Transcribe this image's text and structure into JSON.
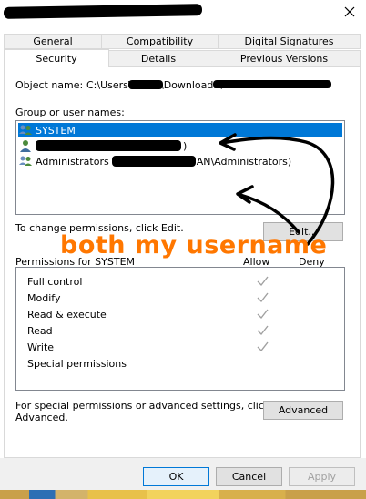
{
  "window": {
    "close_glyph": "✕"
  },
  "tabs": {
    "general": "General",
    "compatibility": "Compatibility",
    "digital_signatures": "Digital Signatures",
    "security": "Security",
    "details": "Details",
    "previous_versions": "Previous Versions"
  },
  "object": {
    "label": "Object name:",
    "path_start": "C:\\Users\\",
    "path_mid": "\\Downloads\\"
  },
  "groups": {
    "label": "Group or user names:",
    "items": [
      {
        "name": "SYSTEM",
        "icon": "group-users-icon",
        "selected": true
      },
      {
        "name": "",
        "suffix": ")",
        "icon": "user-icon",
        "selected": false
      },
      {
        "name": "Administrators",
        "suffix": "AN\\Administrators)",
        "icon": "group-users-icon",
        "selected": false
      }
    ]
  },
  "change_perm": {
    "text": "To change permissions, click Edit.",
    "edit_button": "Edit..."
  },
  "permissions": {
    "label": "Permissions for SYSTEM",
    "allow_header": "Allow",
    "deny_header": "Deny",
    "rows": [
      {
        "name": "Full control",
        "allow": true
      },
      {
        "name": "Modify",
        "allow": true
      },
      {
        "name": "Read & execute",
        "allow": true
      },
      {
        "name": "Read",
        "allow": true
      },
      {
        "name": "Write",
        "allow": true
      },
      {
        "name": "Special permissions",
        "allow": false
      }
    ]
  },
  "advanced": {
    "text_line1": "For special permissions or advanced settings, click",
    "text_line2": "Advanced.",
    "button": "Advanced"
  },
  "buttons": {
    "ok": "OK",
    "cancel": "Cancel",
    "apply": "Apply"
  },
  "annotation": {
    "text": "both my username",
    "color": "#ff7700"
  },
  "colors": {
    "selection": "#0078d7",
    "check": "#a0a0a0",
    "annotation_arrow": "#000000"
  }
}
